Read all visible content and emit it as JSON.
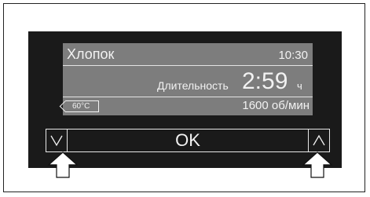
{
  "display": {
    "program": "Хлопок",
    "time": "10:30",
    "duration_label": "Длительность",
    "duration_value": "2:59",
    "duration_unit": "ч",
    "temperature": "60°C",
    "spin_speed": "1600 об/мин"
  },
  "buttons": {
    "down_icon": "chevron-down-icon",
    "ok_label": "OK",
    "up_icon": "chevron-up-icon"
  },
  "pointers": {
    "icon": "arrow-up-icon",
    "targets": [
      "down-button",
      "up-button"
    ]
  },
  "colors": {
    "panel": "#1a1a1a",
    "screen": "#7d7d7d",
    "text": "#f2f2f2"
  }
}
